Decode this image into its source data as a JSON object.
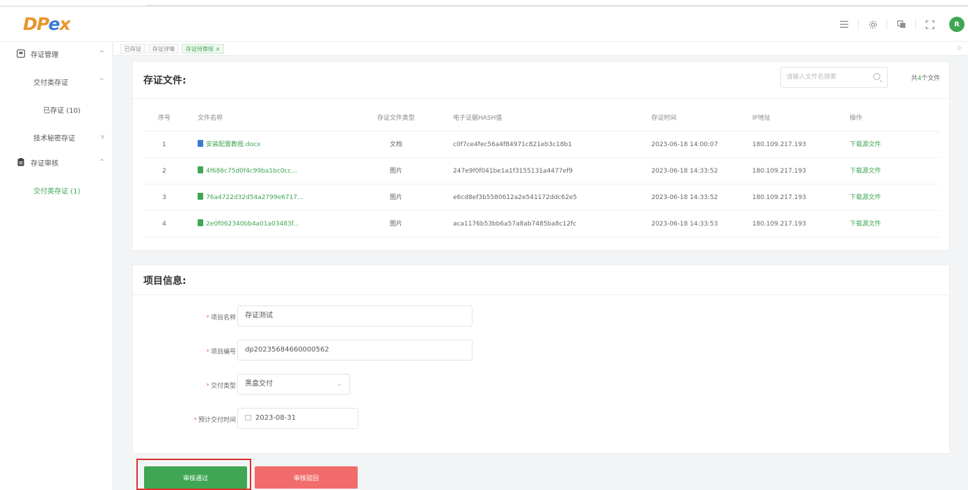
{
  "app": {
    "logo": "DPex",
    "logo_parts": [
      "DP",
      "e",
      "x"
    ],
    "avatar_initial": "R",
    "brand_color": "#3fa653"
  },
  "header": {
    "icons": [
      "list-icon",
      "settings-icon",
      "copy-icon",
      "fullscreen-icon"
    ]
  },
  "sidebar": {
    "items": [
      {
        "label": "存证管理",
        "icon": "certificate-icon",
        "arrow": "^"
      },
      {
        "label": "交付类存证",
        "arrow": "^"
      },
      {
        "label": "已存证 (10)"
      },
      {
        "label": "技术秘密存证",
        "arrow": "v"
      },
      {
        "label": "存证审核",
        "icon": "audit-icon",
        "arrow": "^"
      },
      {
        "label": "交付类存证 (1)"
      }
    ]
  },
  "tags": {
    "items": [
      "已存证",
      "存证详情",
      "存证待审核 ×"
    ],
    "right": "◇"
  },
  "files": {
    "title": "存证文件:",
    "search_placeholder": "请输入文件名搜索",
    "count_prefix": "共",
    "count_value": "4",
    "count_suffix": "个文件",
    "columns": [
      "序号",
      "文件名称",
      "存证文件类型",
      "电子证据HASH值",
      "存证时间",
      "IP地址",
      "操作"
    ],
    "rows": [
      {
        "index": "1",
        "name": "安装配置教程.docx",
        "type": "文档",
        "hash": "c0f7ce4fec56a4f84971c821eb3c18b1",
        "time": "2023-06-18 14:00:07",
        "ip": "180.109.217.193",
        "action": "下载源文件",
        "icon_color": "#3b7bd4"
      },
      {
        "index": "2",
        "name": "4f686c75d0f4c99ba1bc0cc...",
        "type": "图片",
        "hash": "247e9f0f041be1a1f3155131a4477ef9",
        "time": "2023-06-18 14:33:52",
        "ip": "180.109.217.193",
        "action": "下载源文件",
        "icon_color": "#3fa653"
      },
      {
        "index": "3",
        "name": "76a4722d32d54a2799e6717...",
        "type": "图片",
        "hash": "e6cd8ef3b5580612a2e541172ddc62e5",
        "time": "2023-06-18 14:33:52",
        "ip": "180.109.217.193",
        "action": "下载源文件",
        "icon_color": "#3fa653"
      },
      {
        "index": "4",
        "name": "2e0f062340bb4a01a03483f...",
        "type": "图片",
        "hash": "aca1176b53bb6a57a8ab7485ba8c12fc",
        "time": "2023-06-18 14:33:53",
        "ip": "180.109.217.193",
        "action": "下载源文件",
        "icon_color": "#3fa653"
      }
    ]
  },
  "project": {
    "title": "项目信息:",
    "name_label": "项目名称",
    "name_value": "存证测试",
    "code_label": "项目编号",
    "code_value": "dp20235684660000562",
    "type_label": "交付类型",
    "type_value": "黑盒交付",
    "date_label": "预计交付时间",
    "date_value": "2023-08-31",
    "required_mark": "*"
  },
  "actions": {
    "approve": "审核通过",
    "reject": "审核驳回"
  }
}
